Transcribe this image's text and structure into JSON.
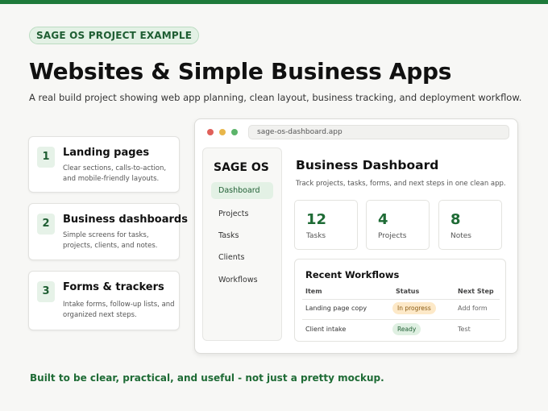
{
  "header": {
    "badge": "SAGE OS PROJECT EXAMPLE",
    "title": "Websites & Simple Business Apps",
    "subtitle": "A real build project showing web app planning, clean layout, business tracking, and deployment  workflow."
  },
  "features": [
    {
      "number": "1",
      "title": "Landing pages",
      "description": "Clear sections, calls-to-action, and mobile-friendly layouts."
    },
    {
      "number": "2",
      "title": "Business dashboards",
      "description": "Simple screens for tasks, projects, clients, and notes."
    },
    {
      "number": "3",
      "title": "Forms & trackers",
      "description": "Intake forms, follow-up lists, and organized next steps."
    }
  ],
  "footer": {
    "tagline": "Built to be clear, practical, and useful - not just a pretty mockup."
  },
  "browser": {
    "url": "sage-os-dashboard.app",
    "colors": {
      "close": "#e0605a",
      "minimize": "#e8b64a",
      "maximize": "#5cb46a"
    }
  },
  "app": {
    "brand": "SAGE OS",
    "nav": [
      "Dashboard",
      "Projects",
      "Tasks",
      "Clients",
      "Workflows"
    ],
    "active_nav": "Dashboard",
    "dashboard_title": "Business Dashboard",
    "dashboard_subtitle": "Track projects, tasks, forms, and next steps in one clean app.",
    "stats": [
      {
        "value": "12",
        "label": "Tasks"
      },
      {
        "value": "4",
        "label": "Projects"
      },
      {
        "value": "8",
        "label": "Notes"
      }
    ],
    "workflows": {
      "title": "Recent Workflows",
      "columns": [
        "Item",
        "Status",
        "Next Step"
      ],
      "rows": [
        {
          "item": "Landing page copy",
          "status": "In progress",
          "next_step": "Add form"
        },
        {
          "item": "Client intake",
          "status": "Ready",
          "next_step": "Test"
        }
      ]
    }
  },
  "theme": {
    "accent": "#1e7a3a",
    "accent_light": "#e3f1e5",
    "progress": "#fde9c8",
    "ready": "#dff0e2"
  }
}
